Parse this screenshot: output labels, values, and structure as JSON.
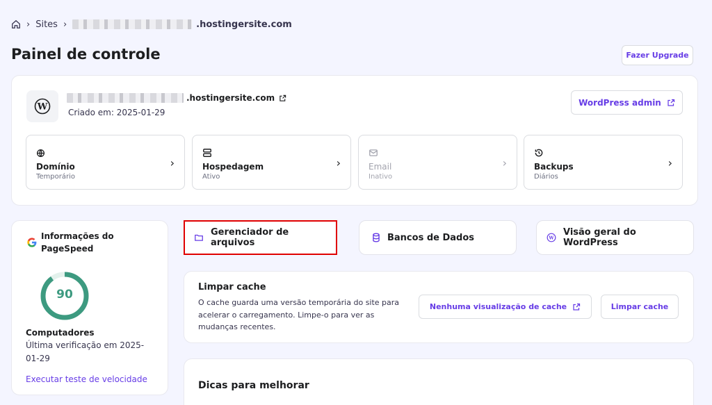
{
  "breadcrumb": {
    "sites_label": "Sites",
    "domain_suffix": ".hostingersite.com"
  },
  "page": {
    "title": "Painel de controle",
    "upgrade_label": "Fazer Upgrade"
  },
  "site": {
    "domain_suffix": ".hostingersite.com",
    "created": "Criado em: 2025-01-29",
    "wp_admin_label": "WordPress admin"
  },
  "tiles": [
    {
      "title": "Domínio",
      "sub": "Temporário",
      "icon": "globe-icon"
    },
    {
      "title": "Hospedagem",
      "sub": "Ativo",
      "icon": "server-icon"
    },
    {
      "title": "Email",
      "sub": "Inativo",
      "icon": "mail-icon"
    },
    {
      "title": "Backups",
      "sub": "Diários",
      "icon": "history-icon"
    }
  ],
  "pagespeed": {
    "title": "Informações do PageSpeed",
    "score": "90",
    "score_fraction": 0.9,
    "device": "Computadores",
    "last_check": "Última verificação em 2025-01-29",
    "run_link": "Executar teste de velocidade",
    "accent": "#3d9a80"
  },
  "nav": {
    "files": "Gerenciador de arquivos",
    "databases": "Bancos de Dados",
    "wp_overview": "Visão geral do WordPress"
  },
  "cache": {
    "title": "Limpar cache",
    "description": "O cache guarda uma versão temporária do site para acelerar o carregamento. Limpe-o para ver as mudanças recentes.",
    "preview_label": "Nenhuma visualização de cache",
    "clear_label": "Limpar cache"
  },
  "tips": {
    "title": "Dicas para melhorar"
  },
  "colors": {
    "accent": "#673de6",
    "highlight": "#e00000"
  }
}
